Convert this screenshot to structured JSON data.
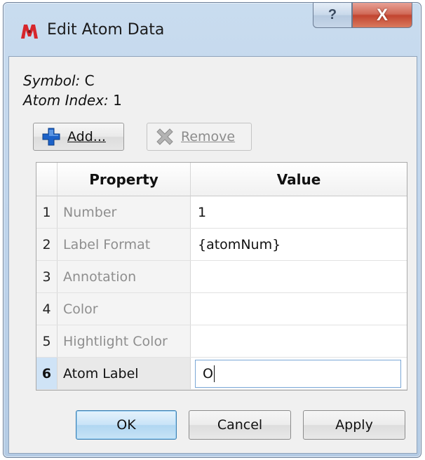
{
  "window": {
    "title": "Edit Atom Data",
    "help_glyph": "?",
    "close_glyph": "X",
    "app_icon": "molecule-app-icon"
  },
  "info": {
    "symbol_key": "Symbol:",
    "symbol_value": "C",
    "atom_index_key": "Atom Index:",
    "atom_index_value": "1"
  },
  "toolbar": {
    "add_label": "Add...",
    "add_icon": "plus-icon",
    "remove_label": "Remove",
    "remove_icon": "x-icon",
    "remove_enabled": false
  },
  "table": {
    "headers": [
      "Property",
      "Value"
    ],
    "rows": [
      {
        "index": "1",
        "property": "Number",
        "value": "1"
      },
      {
        "index": "2",
        "property": "Label Format",
        "value": "{atomNum}"
      },
      {
        "index": "3",
        "property": "Annotation",
        "value": ""
      },
      {
        "index": "4",
        "property": "Color",
        "value": ""
      },
      {
        "index": "5",
        "property": "Hightlight Color",
        "value": ""
      },
      {
        "index": "6",
        "property": "Atom Label",
        "value": "O"
      }
    ],
    "active_row": 6
  },
  "buttons": {
    "ok": "OK",
    "cancel": "Cancel",
    "apply": "Apply"
  },
  "colors": {
    "accent": "#1a5fc4",
    "close_red": "#c24530",
    "selection": "#cfe3f6"
  }
}
